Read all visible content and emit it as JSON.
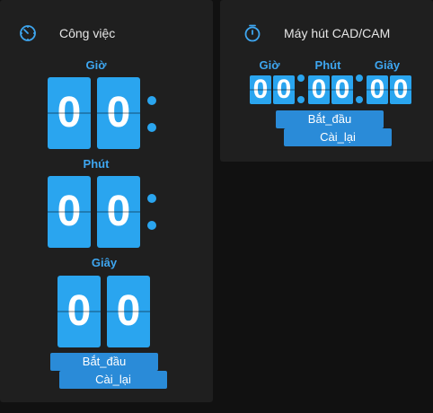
{
  "colors": {
    "accent": "#2aa5ef",
    "button": "#2a8bd8",
    "card": "#1f1f1f",
    "background": "#111111"
  },
  "timer_work": {
    "title": "Công việc",
    "icon": "timer-icon",
    "hours_label": "Giờ",
    "minutes_label": "Phút",
    "seconds_label": "Giây",
    "hours": [
      "0",
      "0"
    ],
    "minutes": [
      "0",
      "0"
    ],
    "seconds": [
      "0",
      "0"
    ],
    "start_label": "Bắt_đầu",
    "reset_label": "Cài_lại"
  },
  "timer_cadcam": {
    "title": "Máy hút CAD/CAM",
    "icon": "stopwatch-icon",
    "hours_label": "Giờ",
    "minutes_label": "Phút",
    "seconds_label": "Giây",
    "hours": [
      "0",
      "0"
    ],
    "minutes": [
      "0",
      "0"
    ],
    "seconds": [
      "0",
      "0"
    ],
    "start_label": "Bắt_đầu",
    "reset_label": "Cài_lại"
  }
}
